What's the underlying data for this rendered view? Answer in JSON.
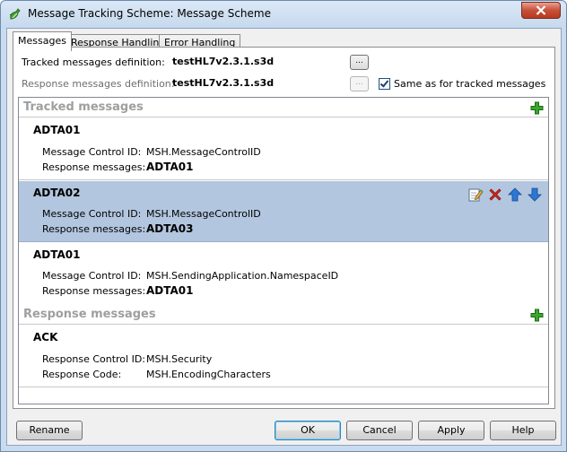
{
  "window": {
    "title": "Message Tracking Scheme: Message Scheme"
  },
  "tabs": [
    "Messages",
    "Response Handling",
    "Error Handling"
  ],
  "definitions": {
    "tracked_label": "Tracked messages definition:",
    "tracked_value": "testHL7v2.3.1.s3d",
    "response_label": "Response messages definition:",
    "response_value": "testHL7v2.3.1.s3d",
    "browse_label": "...",
    "same_as_label": "Same as for tracked messages",
    "same_as_checked": true
  },
  "tracked_section": {
    "title": "Tracked messages",
    "entries": [
      {
        "name": "ADTA01",
        "control_label": "Message Control ID:",
        "control_value": "MSH.MessageControlID",
        "response_label": "Response messages:",
        "response_value": "ADTA01",
        "selected": false
      },
      {
        "name": "ADTA02",
        "control_label": "Message Control ID:",
        "control_value": "MSH.MessageControlID",
        "response_label": "Response messages:",
        "response_value": "ADTA03",
        "selected": true
      },
      {
        "name": "ADTA01",
        "control_label": "Message Control ID:",
        "control_value": "MSH.SendingApplication.NamespaceID",
        "response_label": "Response messages:",
        "response_value": "ADTA01",
        "selected": false
      }
    ]
  },
  "response_section": {
    "title": "Response messages",
    "entries": [
      {
        "name": "ACK",
        "control_label": "Response Control ID:",
        "control_value": "MSH.Security",
        "code_label": "Response Code:",
        "code_value": "MSH.EncodingCharacters"
      }
    ]
  },
  "icons": {
    "app": "scheme-app-icon",
    "add": "green-plus-icon",
    "edit": "edit-icon",
    "delete": "red-x-delete-icon",
    "move_up": "blue-up-arrow-icon",
    "move_down": "blue-down-arrow-icon",
    "close": "close-icon"
  },
  "colors": {
    "selected_row": "#b3c6df",
    "section_title": "#9f9f9f",
    "add_green": "#3aa62c",
    "delete_red": "#d6261c",
    "arrow_blue": "#2a78d6"
  },
  "buttons": {
    "rename": "Rename",
    "ok": "OK",
    "cancel": "Cancel",
    "apply": "Apply",
    "help": "Help"
  }
}
